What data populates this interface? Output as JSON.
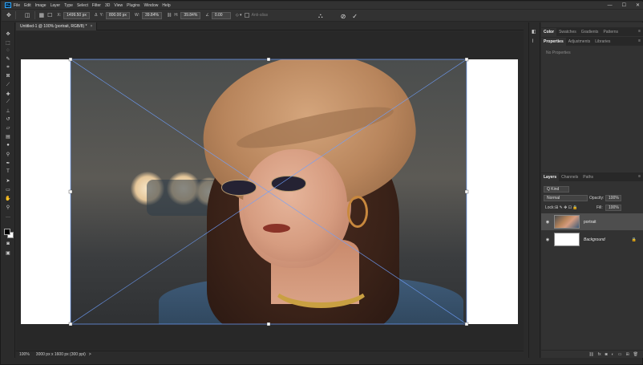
{
  "menubar": {
    "logo": "Ps",
    "items": [
      "File",
      "Edit",
      "Image",
      "Layer",
      "Type",
      "Select",
      "Filter",
      "3D",
      "View",
      "Plugins",
      "Window",
      "Help"
    ],
    "window_controls": [
      "—",
      "☐",
      "✕"
    ]
  },
  "options": {
    "x_label": "X:",
    "x_value": "1499.50 px",
    "y_label": "Y:",
    "y_value": "800.00 px",
    "w_label": "W:",
    "w_value": "39.84%",
    "h_label": "H:",
    "h_value": "39.84%",
    "angle_label": "∠",
    "angle_value": "0.00",
    "antialias_label": "Anti-alias"
  },
  "document": {
    "tab_title": "Untitled-1 @ 100% (portrait, RGB/8) *",
    "tab_close": "×"
  },
  "status": {
    "zoom": "100%",
    "info": "3000 px x 1600 px (300 ppi)",
    "arrow": ">"
  },
  "panels": {
    "top_tabs": [
      "Color",
      "Swatches",
      "Gradients",
      "Patterns"
    ],
    "middle_tabs": [
      "Properties",
      "Adjustments",
      "Libraries"
    ],
    "no_properties": "No Properties",
    "layers_tabs": [
      "Layers",
      "Channels",
      "Paths"
    ],
    "menu_glyph": "≡"
  },
  "layers": {
    "filter_kind": "Q Kind",
    "blend_mode": "Normal",
    "opacity_label": "Opacity:",
    "opacity_value": "100%",
    "lock_label": "Lock:",
    "fill_label": "Fill:",
    "fill_value": "100%",
    "items": [
      {
        "name": "portrait",
        "selected": true
      },
      {
        "name": "Background",
        "selected": false
      }
    ]
  },
  "colors": {
    "app_bg": "#2b2b2b",
    "panel_bg": "#323232",
    "selected_layer": "#4e4e4e",
    "transform_line": "#6fa0ff"
  }
}
